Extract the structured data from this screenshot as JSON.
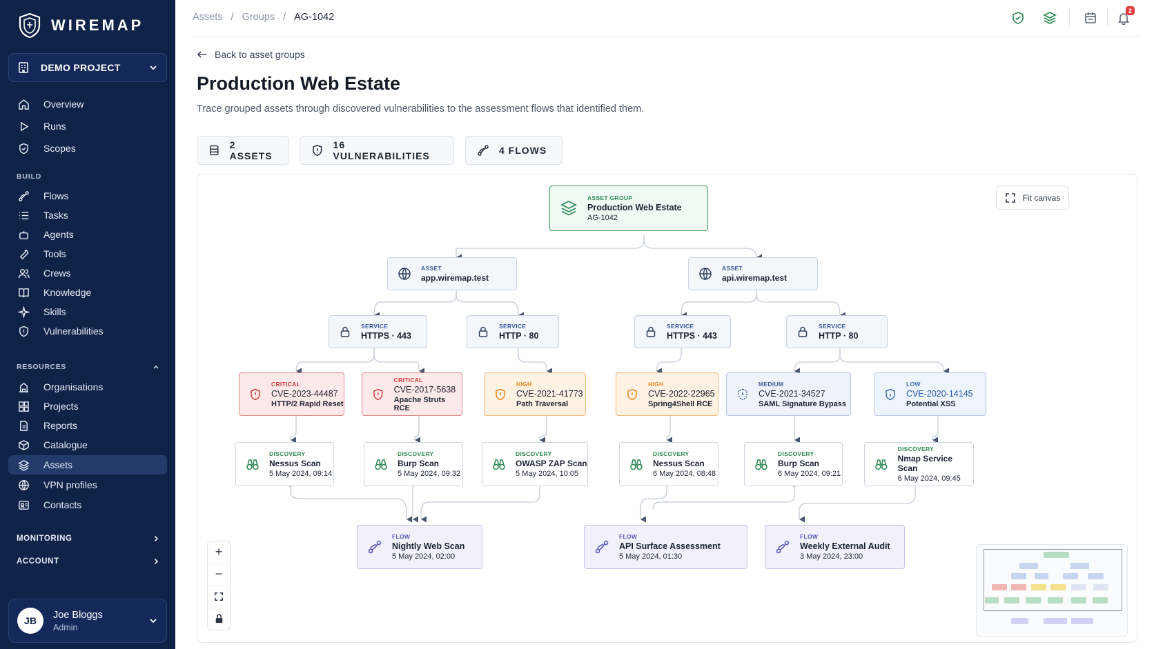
{
  "brand": {
    "name": "WIREMAP"
  },
  "project": {
    "label": "DEMO PROJECT"
  },
  "nav": {
    "main": [
      "Overview",
      "Runs",
      "Scopes"
    ],
    "build_label": "BUILD",
    "build": [
      "Flows",
      "Tasks",
      "Agents",
      "Tools",
      "Crews",
      "Knowledge",
      "Skills",
      "Vulnerabilities"
    ],
    "resources_label": "RESOURCES",
    "resources": [
      "Organisations",
      "Projects",
      "Reports",
      "Catalogue",
      "Assets",
      "VPN profiles",
      "Contacts"
    ],
    "active": "Assets",
    "monitoring_label": "MONITORING",
    "account_label": "ACCOUNT"
  },
  "user": {
    "initials": "JB",
    "name": "Joe Bloggs",
    "role": "Admin"
  },
  "breadcrumb": {
    "items": [
      "Assets",
      "Groups",
      "AG-1042"
    ],
    "sep": "/"
  },
  "notifications": {
    "count": "2"
  },
  "page": {
    "back": "Back to asset groups",
    "title": "Production Web Estate",
    "subtitle": "Trace grouped assets through discovered vulnerabilities to the assessment flows that identified them.",
    "stats": {
      "assets": "2 ASSETS",
      "vulns": "16 VULNERABILITIES",
      "flows": "4 FLOWS"
    }
  },
  "canvas": {
    "fit_label": "Fit canvas",
    "zoom_in": "+",
    "zoom_out": "−",
    "group": {
      "kind": "ASSET GROUP",
      "title": "Production Web Estate",
      "id": "AG-1042"
    },
    "assets": [
      {
        "kind": "ASSET",
        "title": "app.wiremap.test"
      },
      {
        "kind": "ASSET",
        "title": "api.wiremap.test"
      }
    ],
    "services": [
      {
        "kind": "SERVICE",
        "title": "HTTPS · 443"
      },
      {
        "kind": "SERVICE",
        "title": "HTTP · 80"
      },
      {
        "kind": "SERVICE",
        "title": "HTTPS · 443"
      },
      {
        "kind": "SERVICE",
        "title": "HTTP · 80"
      }
    ],
    "vulns": [
      {
        "kind": "CRITICAL",
        "id": "CVE-2023-44487",
        "name": "HTTP/2 Rapid Reset"
      },
      {
        "kind": "CRITICAL",
        "id": "CVE-2017-5638",
        "name": "Apache Struts RCE"
      },
      {
        "kind": "HIGH",
        "id": "CVE-2021-41773",
        "name": "Path Traversal"
      },
      {
        "kind": "HIGH",
        "id": "CVE-2022-22965",
        "name": "Spring4Shell RCE"
      },
      {
        "kind": "MEDIUM",
        "id": "CVE-2021-34527",
        "name": "SAML Signature Bypass"
      },
      {
        "kind": "LOW",
        "id": "CVE-2020-14145",
        "name": "Potential XSS"
      }
    ],
    "discoveries": [
      {
        "kind": "DISCOVERY",
        "title": "Nessus Scan",
        "time": "5 May 2024, 09:14"
      },
      {
        "kind": "DISCOVERY",
        "title": "Burp Scan",
        "time": "5 May 2024, 09:32"
      },
      {
        "kind": "DISCOVERY",
        "title": "OWASP ZAP Scan",
        "time": "5 May 2024, 10:05"
      },
      {
        "kind": "DISCOVERY",
        "title": "Nessus Scan",
        "time": "6 May 2024, 08:48"
      },
      {
        "kind": "DISCOVERY",
        "title": "Burp Scan",
        "time": "6 May 2024, 09:21"
      },
      {
        "kind": "DISCOVERY",
        "title": "Nmap Service Scan",
        "time": "6 May 2024, 09:45"
      }
    ],
    "flows": [
      {
        "kind": "FLOW",
        "title": "Nightly Web Scan",
        "time": "5 May 2024, 02:00"
      },
      {
        "kind": "FLOW",
        "title": "API Surface Assessment",
        "time": "5 May 2024, 01:30"
      },
      {
        "kind": "FLOW",
        "title": "Weekly External Audit",
        "time": "3 May 2024, 23:00"
      }
    ]
  },
  "colors": {
    "sidebar": "#0f2349",
    "critical": "#d23b3b",
    "high": "#e58a1f",
    "medium": "#3f5f9a",
    "low": "#3a6ab2",
    "group": "#2f8a55",
    "flow": "#5b58b8"
  }
}
